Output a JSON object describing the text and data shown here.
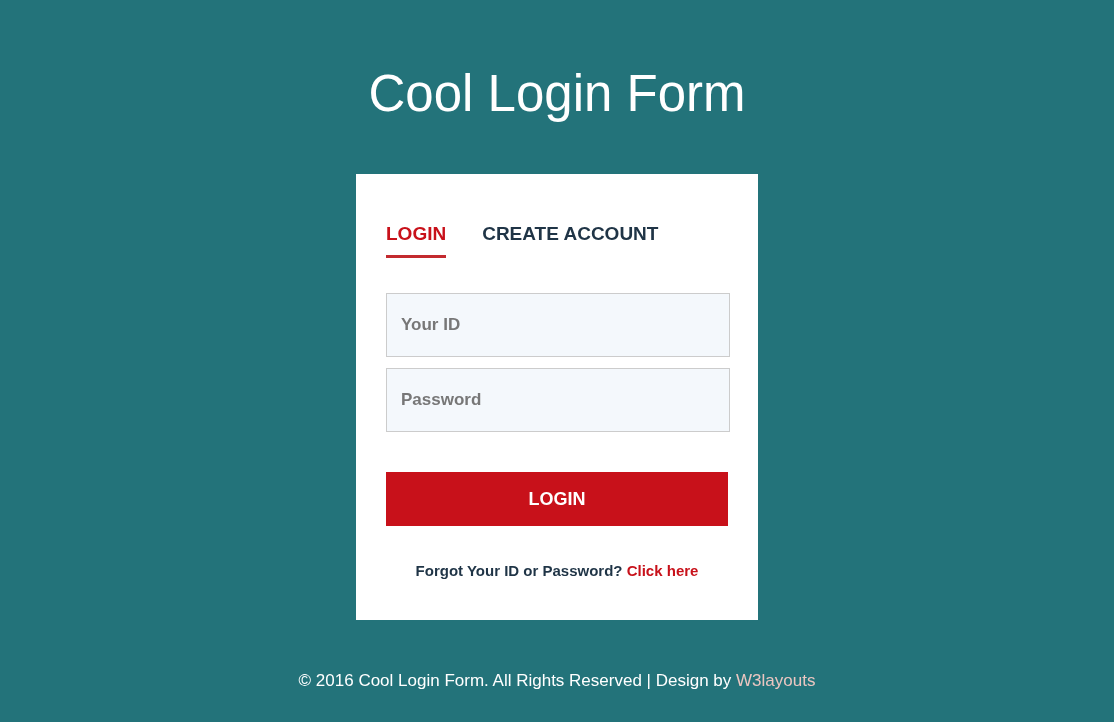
{
  "page": {
    "title": "Cool Login Form"
  },
  "form": {
    "tabs": [
      {
        "label": "LOGIN",
        "selected": true
      },
      {
        "label": "CREATE ACCOUNT",
        "selected": false
      }
    ],
    "fields": [
      {
        "placeholder": "Your ID"
      },
      {
        "placeholder": "Password"
      }
    ],
    "submit_button": "LOGIN",
    "forgot": {
      "text": "Forgot Your ID or Password?",
      "link": "Click here"
    }
  },
  "footer": {
    "text": "© 2016 Cool Login Form. All Rights Reserved | Design by",
    "link": "W3layouts"
  }
}
